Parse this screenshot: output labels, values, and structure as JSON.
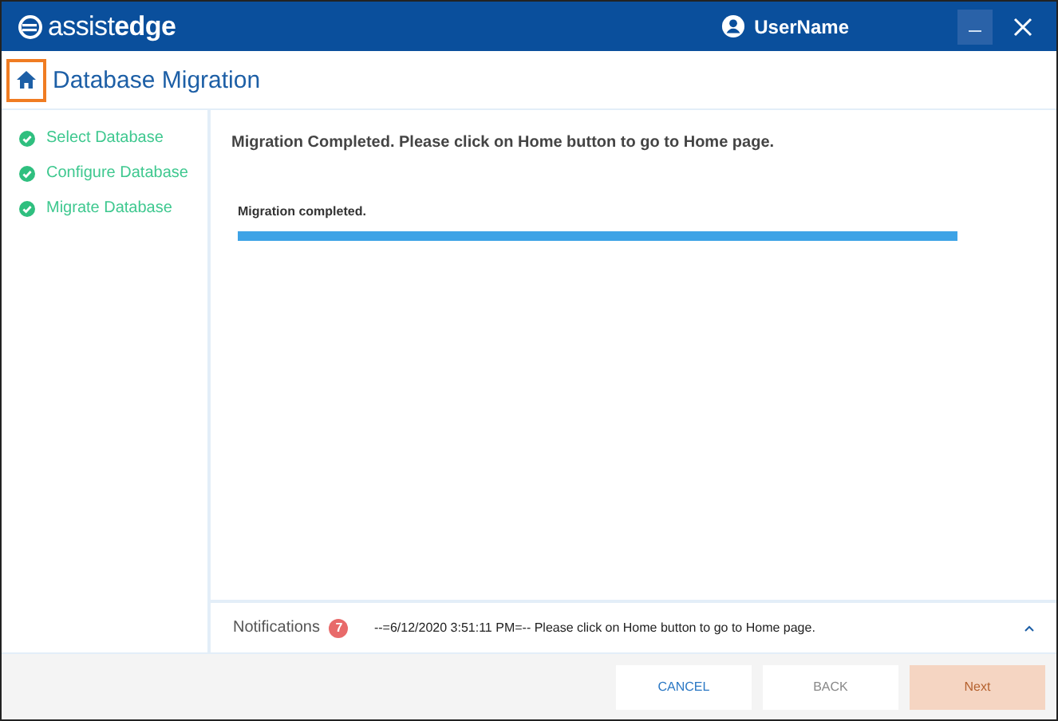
{
  "app": {
    "logo": "assist**edge**",
    "user": "UserName"
  },
  "header": {
    "title": "Database Migration"
  },
  "steps": [
    {
      "label": "Select Database",
      "done": true
    },
    {
      "label": "Configure Database",
      "done": true
    },
    {
      "label": "Migrate Database",
      "done": true
    }
  ],
  "main": {
    "message": "Migration Completed. Please click on Home button to go to Home page.",
    "progress": {
      "label": "Migration completed.",
      "level": 1
    }
  },
  "notifications": {
    "label": "Notifications",
    "count": "7",
    "text": "--=6/12/2020 3:51:11 PM=-- Please click on Home button to go to Home page."
  },
  "buttons": [
    {
      "label": "CANCEL",
      "kind": "cancel",
      "disabled": false
    },
    {
      "label": "BACK",
      "kind": "back",
      "disabled": false
    },
    {
      "label": "Next",
      "kind": "next",
      "disabled": true
    }
  ]
}
